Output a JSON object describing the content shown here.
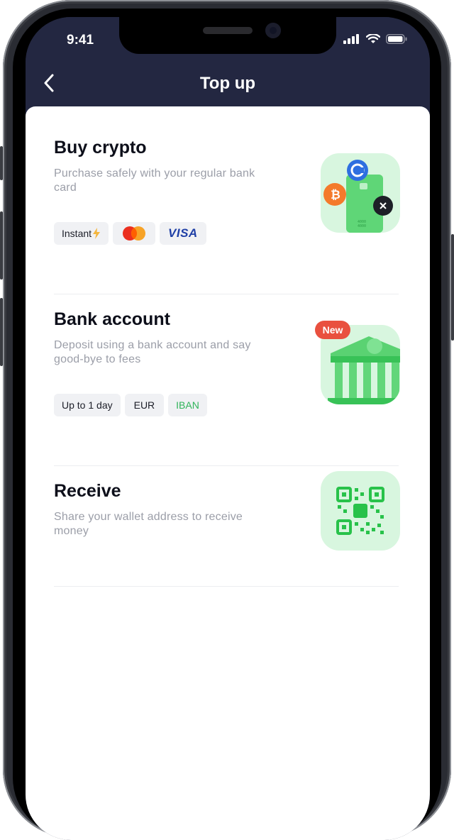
{
  "status_bar": {
    "time": "9:41"
  },
  "header": {
    "title": "Top up"
  },
  "sections": [
    {
      "title": "Buy crypto",
      "description": "Purchase safely with your regular bank card",
      "tags": [
        {
          "label": "Instant",
          "icon": "lightning-icon"
        },
        {
          "label": "",
          "icon": "mastercard-icon"
        },
        {
          "label": "VISA",
          "icon": "visa-logo"
        }
      ],
      "image": "bank-card-crypto-icon"
    },
    {
      "title": "Bank account",
      "description": "Deposit using a bank account and say good-bye to fees",
      "badge": "New",
      "tags": [
        {
          "label": "Up to 1 day"
        },
        {
          "label": "EUR"
        },
        {
          "label": "IBAN",
          "color": "#2fb45a"
        }
      ],
      "image": "bank-building-icon"
    },
    {
      "title": "Receive",
      "description": "Share your wallet address to receive money",
      "image": "qr-code-icon"
    }
  ],
  "colors": {
    "header_bg": "#232741",
    "accent_green": "#2fb45a",
    "tile_bg": "#d8f6df",
    "badge_red": "#e9503f",
    "muted_text": "#9b9ea8"
  }
}
